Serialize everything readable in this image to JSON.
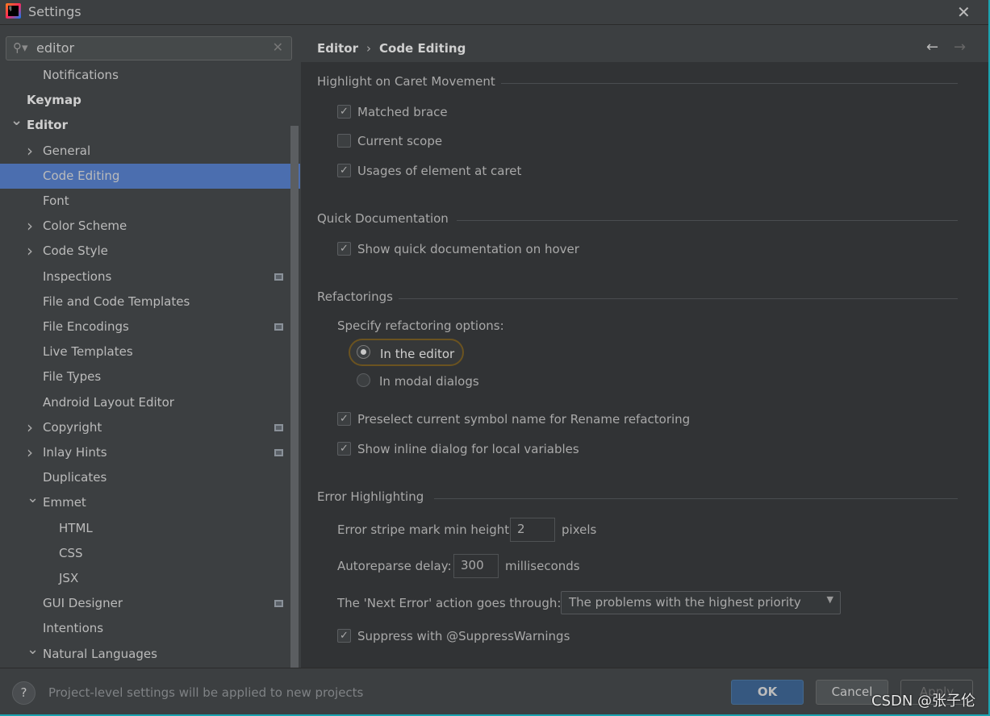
{
  "window": {
    "title": "Settings",
    "close_icon": "close-icon"
  },
  "search": {
    "value": "editor"
  },
  "sidebar": {
    "items": [
      {
        "label": "Notifications",
        "level": 1,
        "arrow": "",
        "bold": false,
        "selected": false,
        "project": false
      },
      {
        "label": "Keymap",
        "level": 0,
        "arrow": "",
        "bold": true,
        "selected": false,
        "project": false
      },
      {
        "label": "Editor",
        "level": 0,
        "arrow": "down",
        "bold": true,
        "selected": false,
        "project": false
      },
      {
        "label": "General",
        "level": 1,
        "arrow": "right",
        "bold": false,
        "selected": false,
        "project": false
      },
      {
        "label": "Code Editing",
        "level": 1,
        "arrow": "",
        "bold": false,
        "selected": true,
        "project": false
      },
      {
        "label": "Font",
        "level": 1,
        "arrow": "",
        "bold": false,
        "selected": false,
        "project": false
      },
      {
        "label": "Color Scheme",
        "level": 1,
        "arrow": "right",
        "bold": false,
        "selected": false,
        "project": false
      },
      {
        "label": "Code Style",
        "level": 1,
        "arrow": "right",
        "bold": false,
        "selected": false,
        "project": false
      },
      {
        "label": "Inspections",
        "level": 1,
        "arrow": "",
        "bold": false,
        "selected": false,
        "project": true
      },
      {
        "label": "File and Code Templates",
        "level": 1,
        "arrow": "",
        "bold": false,
        "selected": false,
        "project": false
      },
      {
        "label": "File Encodings",
        "level": 1,
        "arrow": "",
        "bold": false,
        "selected": false,
        "project": true
      },
      {
        "label": "Live Templates",
        "level": 1,
        "arrow": "",
        "bold": false,
        "selected": false,
        "project": false
      },
      {
        "label": "File Types",
        "level": 1,
        "arrow": "",
        "bold": false,
        "selected": false,
        "project": false
      },
      {
        "label": "Android Layout Editor",
        "level": 1,
        "arrow": "",
        "bold": false,
        "selected": false,
        "project": false
      },
      {
        "label": "Copyright",
        "level": 1,
        "arrow": "right",
        "bold": false,
        "selected": false,
        "project": true
      },
      {
        "label": "Inlay Hints",
        "level": 1,
        "arrow": "right",
        "bold": false,
        "selected": false,
        "project": true
      },
      {
        "label": "Duplicates",
        "level": 1,
        "arrow": "",
        "bold": false,
        "selected": false,
        "project": false
      },
      {
        "label": "Emmet",
        "level": 1,
        "arrow": "down",
        "bold": false,
        "selected": false,
        "project": false
      },
      {
        "label": "HTML",
        "level": 2,
        "arrow": "",
        "bold": false,
        "selected": false,
        "project": false
      },
      {
        "label": "CSS",
        "level": 2,
        "arrow": "",
        "bold": false,
        "selected": false,
        "project": false
      },
      {
        "label": "JSX",
        "level": 2,
        "arrow": "",
        "bold": false,
        "selected": false,
        "project": false
      },
      {
        "label": "GUI Designer",
        "level": 1,
        "arrow": "",
        "bold": false,
        "selected": false,
        "project": true
      },
      {
        "label": "Intentions",
        "level": 1,
        "arrow": "",
        "bold": false,
        "selected": false,
        "project": false
      },
      {
        "label": "Natural Languages",
        "level": 1,
        "arrow": "down",
        "bold": false,
        "selected": false,
        "project": false
      }
    ]
  },
  "breadcrumb": {
    "parent": "Editor",
    "separator": "›",
    "current": "Code Editing"
  },
  "sections": {
    "caret": {
      "title": "Highlight on Caret Movement",
      "options": [
        {
          "label": "Matched brace",
          "checked": true
        },
        {
          "label": "Current scope",
          "checked": false
        },
        {
          "label": "Usages of element at caret",
          "checked": true
        }
      ]
    },
    "quickdoc": {
      "title": "Quick Documentation",
      "options": [
        {
          "label": "Show quick documentation on hover",
          "checked": true
        }
      ]
    },
    "refactor": {
      "title": "Refactorings",
      "prompt": "Specify refactoring options:",
      "radios": [
        {
          "label": "In the editor",
          "selected": true
        },
        {
          "label": "In modal dialogs",
          "selected": false
        }
      ],
      "options": [
        {
          "label": "Preselect current symbol name for Rename refactoring",
          "checked": true
        },
        {
          "label": "Show inline dialog for local variables",
          "checked": true
        }
      ]
    },
    "errors": {
      "title": "Error Highlighting",
      "stripe_label": "Error stripe mark min height:",
      "stripe_value": "2",
      "stripe_unit": "pixels",
      "autoreparse_label": "Autoreparse delay:",
      "autoreparse_value": "300",
      "autoreparse_unit": "milliseconds",
      "next_error_label": "The 'Next Error' action goes through:",
      "next_error_value": "The problems with the highest priority",
      "options": [
        {
          "label": "Suppress with @SuppressWarnings",
          "checked": true
        }
      ]
    }
  },
  "footer": {
    "help": "?",
    "note": "Project-level settings will be applied to new projects",
    "ok": "OK",
    "cancel": "Cancel",
    "apply": "Apply"
  },
  "watermark": "CSDN @张子伦",
  "colors": {
    "selection": "#4b6eaf",
    "ok_button": "#365880",
    "focus_ring": "#6b5320"
  }
}
